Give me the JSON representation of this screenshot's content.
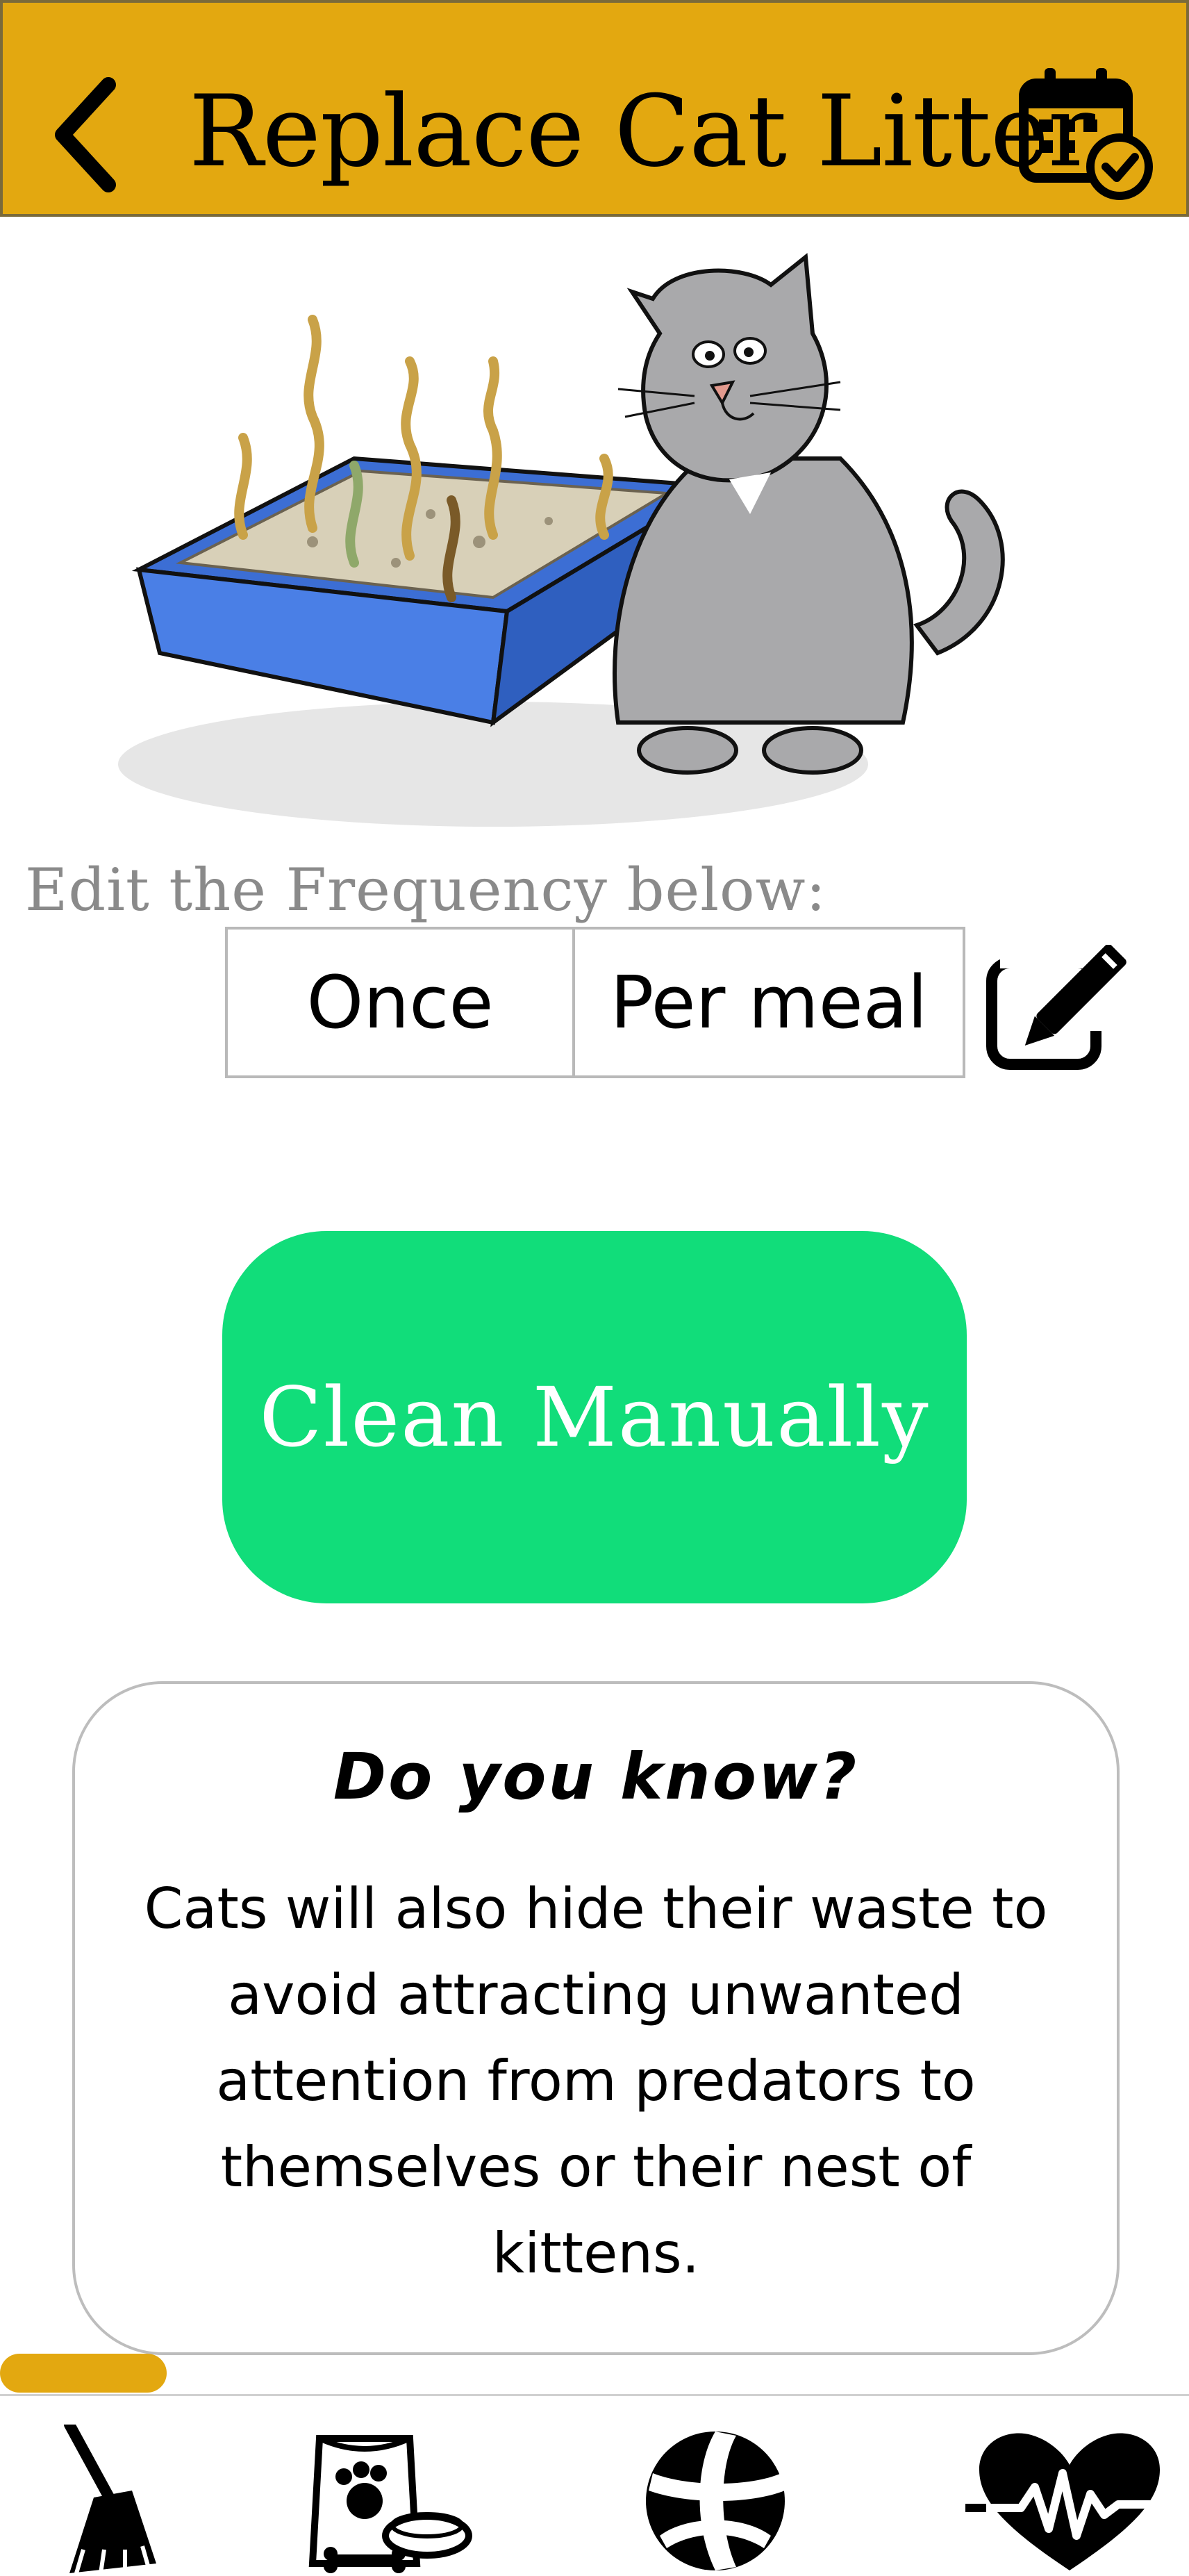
{
  "header": {
    "title": "Replace Cat Litter",
    "back_icon": "chevron-left-icon",
    "calendar_icon": "calendar-check-icon",
    "background_color": "#e3a810"
  },
  "hero": {
    "illustration": "cat-litter-box-illustration"
  },
  "frequency": {
    "label": "Edit the Frequency below:",
    "count": "Once",
    "unit": "Per meal",
    "edit_icon": "edit-icon"
  },
  "action": {
    "clean_label": "Clean Manually",
    "color": "#11dd7a"
  },
  "fact": {
    "title": "Do you know?",
    "text": "Cats will also hide their waste to avoid attracting unwanted attention from predators to themselves or their nest of kittens."
  },
  "progress": {
    "fraction": 0.14,
    "color": "#e3a810"
  },
  "bottom_nav": [
    {
      "name": "cleaning",
      "icon": "broom-icon"
    },
    {
      "name": "feeding",
      "icon": "pet-food-icon"
    },
    {
      "name": "play",
      "icon": "ball-icon"
    },
    {
      "name": "health",
      "icon": "heartbeat-icon"
    }
  ]
}
